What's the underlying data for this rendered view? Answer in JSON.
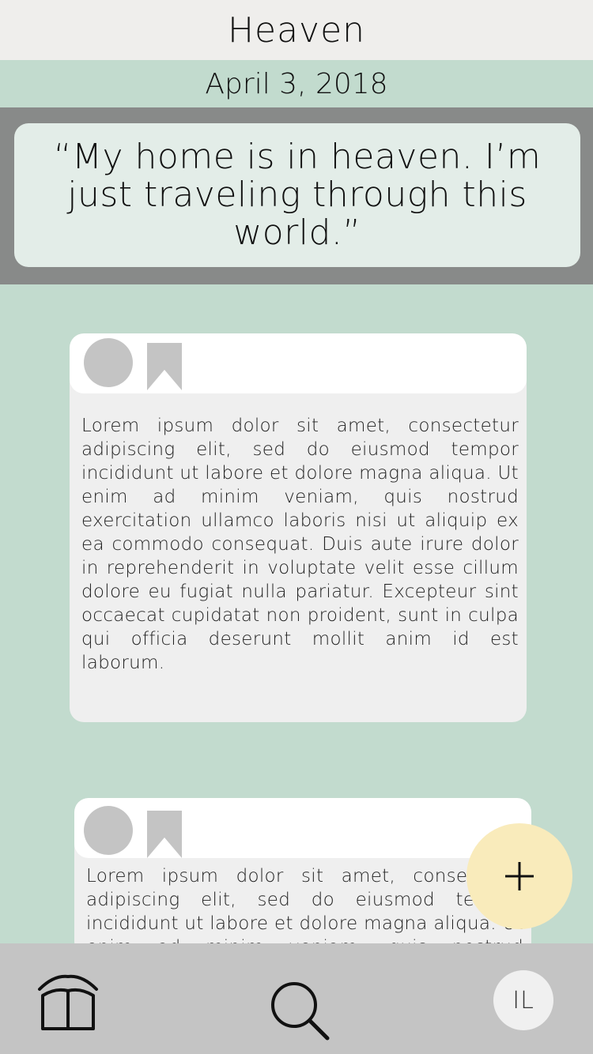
{
  "header": {
    "title": "Heaven"
  },
  "date": "April 3, 2018",
  "quote": "“My home is in heaven. I’m just traveling through this world.”",
  "posts": [
    {
      "body": "Lorem ipsum dolor sit amet, consectetur adipiscing elit, sed do eiusmod tempor incididunt ut labore et dolore magna aliqua. Ut enim ad minim veniam, quis nostrud exercitation ullamco laboris nisi ut aliquip ex ea commodo consequat. Duis aute irure dolor in reprehenderit in voluptate velit esse cillum dolore eu fugiat nulla pariatur. Excepteur sint occaecat cupidatat non proident, sunt in culpa qui officia deserunt mollit anim id est laborum."
    },
    {
      "body": "Lorem ipsum dolor sit amet, consectetur adipiscing elit, sed do eiusmod tempor incididunt ut labore et dolore magna aliqua. Ut enim ad minim veniam, quis nostrud exercitation ullamco laboris nisi ut aliquip ex ea commodo consequat."
    }
  ],
  "fab": {
    "icon": "plus-icon"
  },
  "tabbar": {
    "items": [
      {
        "icon": "book-icon"
      },
      {
        "icon": "search-icon"
      }
    ],
    "profile_initials": "IL"
  },
  "colors": {
    "background": "#c2dbce",
    "header": "#efeeec",
    "quote_band": "#888a89",
    "quote_card": "#e3ede8",
    "fab": "#f9ebbb",
    "tabbar": "#c4c4c4"
  }
}
